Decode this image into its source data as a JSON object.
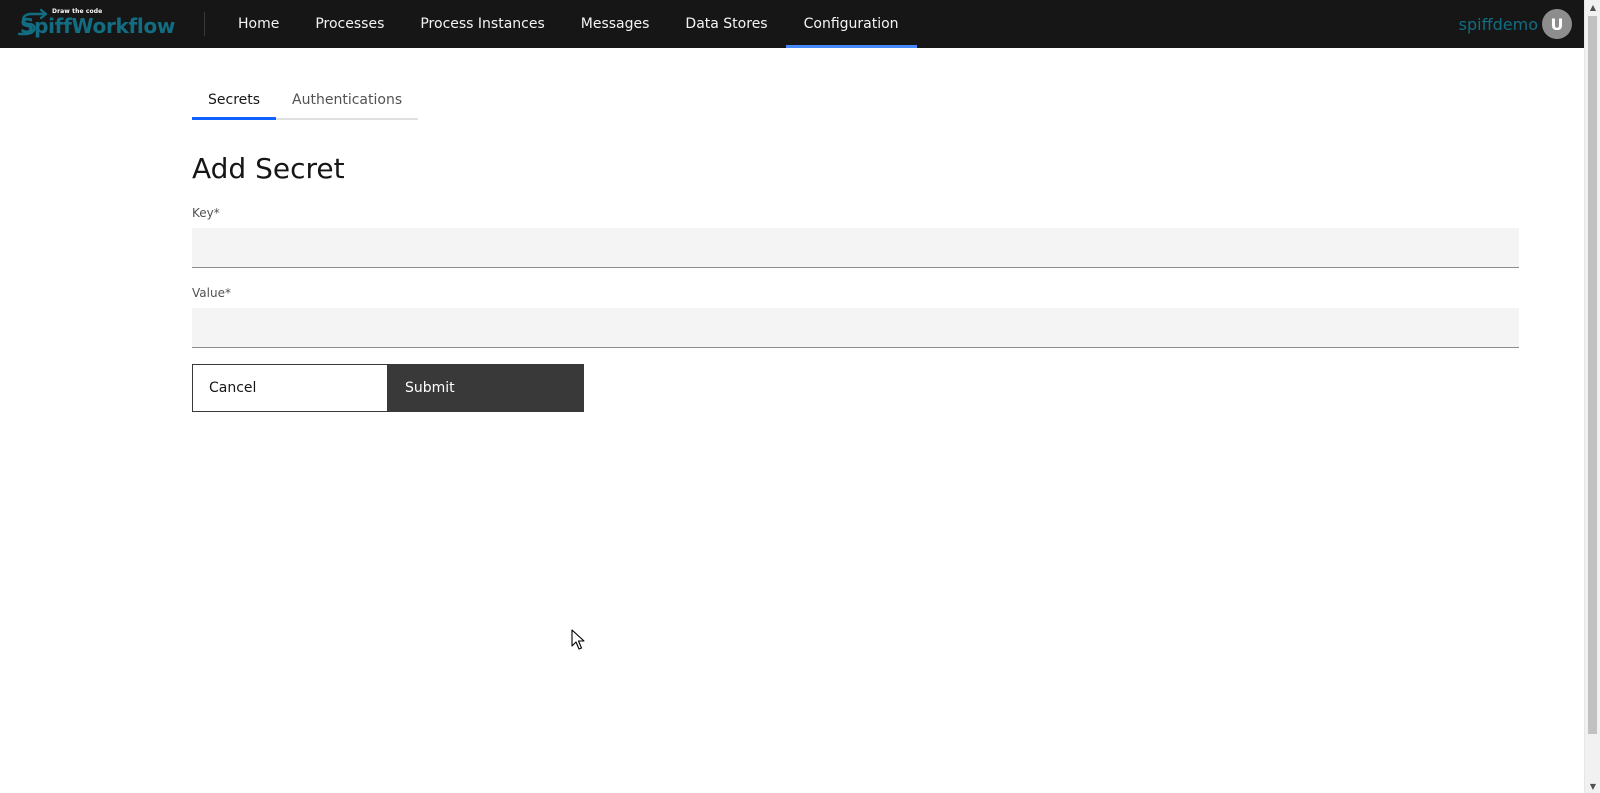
{
  "app": {
    "logo_tagline": "Draw the code",
    "logo_name": "SpiffWorkflow",
    "brand_color": "#126d82"
  },
  "nav": {
    "items": [
      {
        "label": "Home"
      },
      {
        "label": "Processes"
      },
      {
        "label": "Process Instances"
      },
      {
        "label": "Messages"
      },
      {
        "label": "Data Stores"
      },
      {
        "label": "Configuration"
      }
    ],
    "active": "Configuration",
    "active_color": "#4589ff"
  },
  "user": {
    "username": "spiffdemo",
    "avatar_initial": "U"
  },
  "tabs": {
    "items": [
      {
        "label": "Secrets"
      },
      {
        "label": "Authentications"
      }
    ],
    "active": "Secrets"
  },
  "form": {
    "title": "Add Secret",
    "key_label": "Key*",
    "key_value": "",
    "value_label": "Value*",
    "value_value": "",
    "cancel_label": "Cancel",
    "submit_label": "Submit"
  },
  "icons": {
    "cursor": "mouse-pointer-icon",
    "logo_arrow": "flow-arrow-icon",
    "scroll_up": "chevron-up-icon",
    "scroll_down": "chevron-down-icon"
  }
}
